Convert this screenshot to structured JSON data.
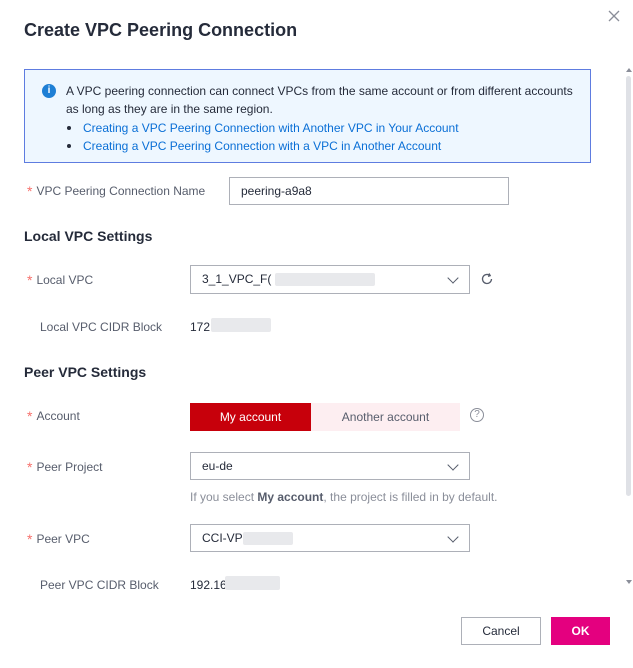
{
  "dialog": {
    "title": "Create VPC Peering Connection"
  },
  "notice": {
    "text": "A VPC peering connection can connect VPCs from the same account or from different accounts as long as they are in the same region.",
    "links": [
      "Creating a VPC Peering Connection with Another VPC in Your Account",
      "Creating a VPC Peering Connection with a VPC in Another Account"
    ]
  },
  "form": {
    "name_label": "VPC Peering Connection Name",
    "name_value": "peering-a9a8",
    "local_section": "Local VPC Settings",
    "local_vpc_label": "Local VPC",
    "local_vpc_value": "3_1_VPC_F(",
    "local_cidr_label": "Local VPC CIDR Block",
    "local_cidr_value": "172",
    "peer_section": "Peer VPC Settings",
    "account_label": "Account",
    "account_options": [
      "My account",
      "Another account"
    ],
    "account_selected": "My account",
    "peer_project_label": "Peer Project",
    "peer_project_value": "eu-de",
    "hint_prefix": "If you select ",
    "hint_bold": "My account",
    "hint_suffix": ", the project is filled in by default.",
    "peer_vpc_label": "Peer VPC",
    "peer_vpc_value": "CCI-VP",
    "peer_cidr_label": "Peer VPC CIDR Block",
    "peer_cidr_value": "192.16"
  },
  "footer": {
    "cancel_label": "Cancel",
    "ok_label": "OK"
  },
  "colors": {
    "accent": "#c7000b",
    "ok_button": "#e4007f",
    "link": "#0a6fd6",
    "notice_border": "#5e7ce0",
    "required": "#f66f6a"
  },
  "icons": [
    "close-icon",
    "info-icon",
    "chevron-down-icon",
    "refresh-icon",
    "help-icon"
  ]
}
